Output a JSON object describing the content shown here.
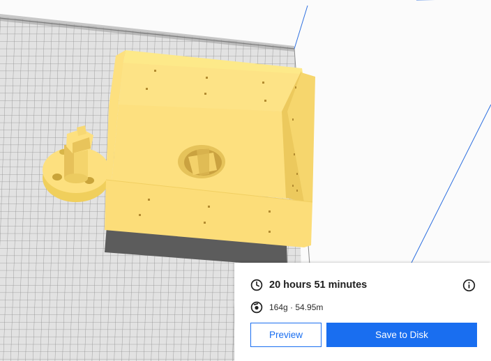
{
  "print_panel": {
    "time_icon": "clock-icon",
    "print_time": "20 hours 51 minutes",
    "material_icon": "filament-spool-icon",
    "material_usage": "164g · 54.95m",
    "info_icon": "info-icon",
    "preview_label": "Preview",
    "save_label": "Save to Disk"
  },
  "colors": {
    "accent": "#196ef0",
    "model": "#fde07f",
    "build_plate": "#dedede",
    "plate_grid": "#8c8c8c",
    "volume_edge": "#2d6fe0"
  }
}
